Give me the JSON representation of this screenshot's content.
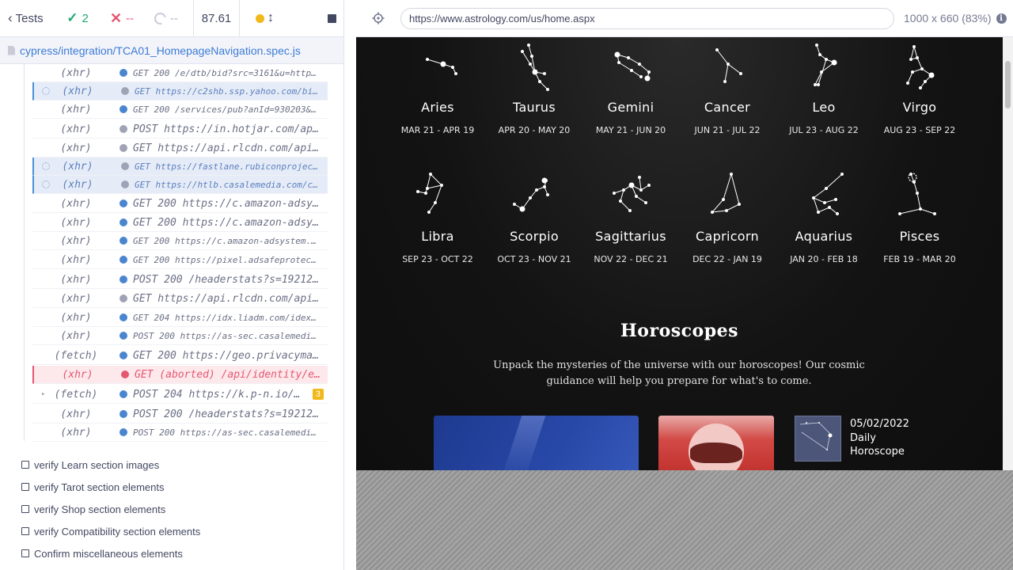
{
  "reporter": {
    "tests_label": "Tests",
    "passed": "2",
    "failed": "--",
    "pending": "--",
    "duration": "87.61",
    "spec_path": "cypress/integration/TCA01_HomepageNavigation.spec.js"
  },
  "command_log": [
    {
      "type": "(xhr)",
      "dot": "blue",
      "state": "normal",
      "size": "sm",
      "msg": "GET 200 /e/dtb/bid?src=3161&u=https://..."
    },
    {
      "type": "(xhr)",
      "dot": "gray",
      "state": "pending",
      "size": "sm",
      "msg": "GET https://c2shb.ssp.yahoo.com/bidReq..."
    },
    {
      "type": "(xhr)",
      "dot": "blue",
      "state": "normal",
      "size": "sm",
      "msg": "GET 200 /services/pub?anId=930203&slot..."
    },
    {
      "type": "(xhr)",
      "dot": "gray",
      "state": "normal",
      "size": "lg",
      "msg": "POST https://in.hotjar.com/api/..."
    },
    {
      "type": "(xhr)",
      "dot": "gray",
      "state": "normal",
      "size": "lg",
      "msg": "GET https://api.rlcdn.com/api/i..."
    },
    {
      "type": "(xhr)",
      "dot": "gray",
      "state": "pending",
      "size": "sm",
      "msg": "GET https://fastlane.rubiconproject.co..."
    },
    {
      "type": "(xhr)",
      "dot": "gray",
      "state": "pending",
      "size": "sm",
      "msg": "GET https://htlb.casalemedia.com/cygnu..."
    },
    {
      "type": "(xhr)",
      "dot": "blue",
      "state": "normal",
      "size": "lg",
      "msg": "GET 200 https://c.amazon-adsyst..."
    },
    {
      "type": "(xhr)",
      "dot": "blue",
      "state": "normal",
      "size": "lg",
      "msg": "GET 200 https://c.amazon-adsyst..."
    },
    {
      "type": "(xhr)",
      "dot": "blue",
      "state": "normal",
      "size": "sm",
      "msg": "GET 200 https://c.amazon-adsystem.com/..."
    },
    {
      "type": "(xhr)",
      "dot": "blue",
      "state": "normal",
      "size": "sm",
      "msg": "GET 200 https://pixel.adsafeprotected..."
    },
    {
      "type": "(xhr)",
      "dot": "blue",
      "state": "normal",
      "size": "lg",
      "msg": "POST 200 /headerstats?s=192126&..."
    },
    {
      "type": "(xhr)",
      "dot": "gray",
      "state": "normal",
      "size": "lg",
      "msg": "GET https://api.rlcdn.com/api/i..."
    },
    {
      "type": "(xhr)",
      "dot": "blue",
      "state": "normal",
      "size": "sm",
      "msg": "GET 204 https://idx.liadm.com/idex/ie/..."
    },
    {
      "type": "(xhr)",
      "dot": "blue",
      "state": "normal",
      "size": "sm",
      "msg": "POST 200 https://as-sec.casalemedia.co..."
    },
    {
      "type": "(fetch)",
      "dot": "blue",
      "state": "normal",
      "size": "lg",
      "msg": "GET 200 https://geo.privacymana..."
    },
    {
      "type": "(xhr)",
      "dot": "red",
      "state": "failed",
      "size": "lg",
      "msg": "GET (aborted) /api/identity/env..."
    },
    {
      "type": "(fetch)",
      "dot": "blue",
      "state": "expandable",
      "size": "lg",
      "msg": "POST 204 https://k.p-n.io/even...",
      "badge": "3"
    },
    {
      "type": "(xhr)",
      "dot": "blue",
      "state": "normal",
      "size": "lg",
      "msg": "POST 200 /headerstats?s=192126&..."
    },
    {
      "type": "(xhr)",
      "dot": "blue",
      "state": "normal",
      "size": "sm",
      "msg": "POST 200 https://as-sec.casalemedia.co..."
    }
  ],
  "tests": [
    "verify Learn section images",
    "verify Tarot section elements",
    "verify Shop section elements",
    "verify Compatibility section elements",
    "Confirm miscellaneous elements"
  ],
  "aut": {
    "url": "https://www.astrology.com/us/home.aspx",
    "viewport": "1000 x 660",
    "scale": "(83%)"
  },
  "zodiac": [
    {
      "name": "Aries",
      "dates": "MAR 21 - APR 19"
    },
    {
      "name": "Taurus",
      "dates": "APR 20 - MAY 20"
    },
    {
      "name": "Gemini",
      "dates": "MAY 21 - JUN 20"
    },
    {
      "name": "Cancer",
      "dates": "JUN 21 - JUL 22"
    },
    {
      "name": "Leo",
      "dates": "JUL 23 - AUG 22"
    },
    {
      "name": "Virgo",
      "dates": "AUG 23 - SEP 22"
    },
    {
      "name": "Libra",
      "dates": "SEP 23 - OCT 22"
    },
    {
      "name": "Scorpio",
      "dates": "OCT 23 - NOV 21"
    },
    {
      "name": "Sagittarius",
      "dates": "NOV 22 - DEC 21"
    },
    {
      "name": "Capricorn",
      "dates": "DEC 22 - JAN 19"
    },
    {
      "name": "Aquarius",
      "dates": "JAN 20 - FEB 18"
    },
    {
      "name": "Pisces",
      "dates": "FEB 19 - MAR 20"
    }
  ],
  "horoscopes": {
    "title": "Horoscopes",
    "subtitle": "Unpack the mysteries of the universe with our horoscopes! Our cosmic guidance will help you prepare for what's to come.",
    "daily_date": "05/02/2022",
    "daily_line1": "Daily",
    "daily_line2": "Horoscope"
  },
  "colors": {
    "pass": "#1fa971",
    "fail": "#e45770",
    "link": "#3b7bd4",
    "page_bg": "#101010"
  }
}
